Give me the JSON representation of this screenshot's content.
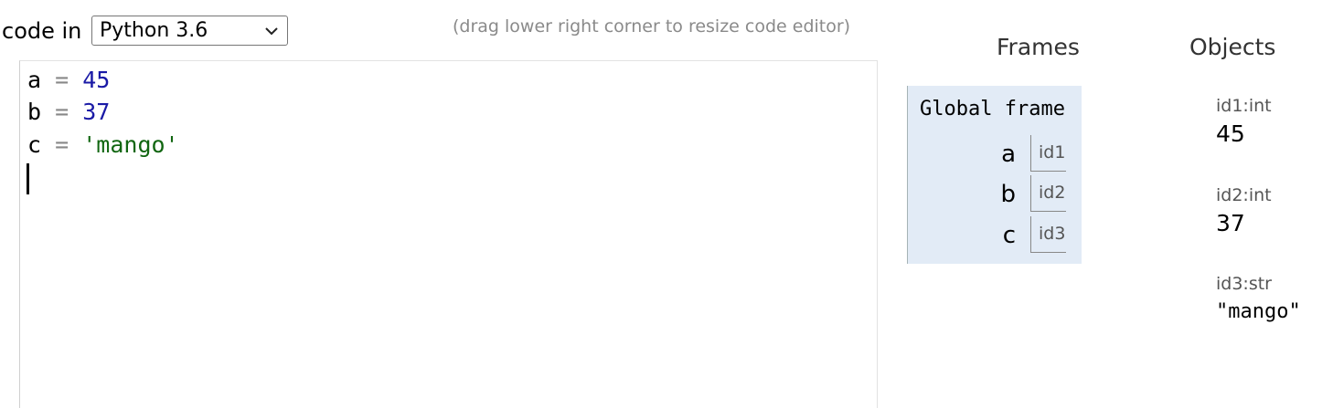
{
  "header": {
    "code_in_label": "code in",
    "language_select": {
      "selected": "Python 3.6",
      "icon": "chevron-down-icon"
    },
    "resize_hint": "(drag lower right corner to resize code editor)"
  },
  "editor": {
    "lines": [
      {
        "var": "a",
        "op": "=",
        "value": "45",
        "value_kind": "number"
      },
      {
        "var": "b",
        "op": "=",
        "value": "37",
        "value_kind": "number"
      },
      {
        "var": "c",
        "op": "=",
        "value": "'mango'",
        "value_kind": "string"
      }
    ],
    "colors": {
      "number": "#1a1aa6",
      "string": "#116611",
      "operator": "#888888"
    }
  },
  "frames": {
    "heading": "Frames",
    "global_frame": {
      "title": "Global frame",
      "variables": [
        {
          "name": "a",
          "ref": "id1"
        },
        {
          "name": "b",
          "ref": "id2"
        },
        {
          "name": "c",
          "ref": "id3"
        }
      ],
      "background_color": "#e2ebf6"
    }
  },
  "objects": {
    "heading": "Objects",
    "items": [
      {
        "label": "id1:int",
        "value": "45"
      },
      {
        "label": "id2:int",
        "value": "37"
      },
      {
        "label": "id3:str",
        "value": "\"mango\""
      }
    ]
  }
}
